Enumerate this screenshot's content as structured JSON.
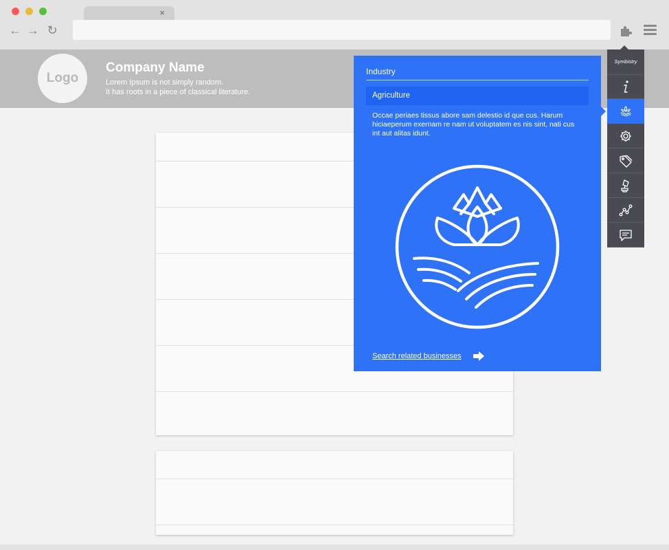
{
  "browser": {
    "colors": {
      "close": "#fc5b57",
      "minimize": "#e5bf3c",
      "maximize": "#57c038"
    },
    "tab_close_label": "×",
    "nav": {
      "back_icon": "←",
      "forward_icon": "→",
      "reload_icon": "↻"
    }
  },
  "site": {
    "logo_text": "Logo",
    "company_name": "Company Name",
    "tagline_line1": "Lorem Ipsum is not simply random.",
    "tagline_line2": "It has roots in a piece of classical literature."
  },
  "popup": {
    "title": "Industry",
    "selected": "Agriculture",
    "description": "Occae periaes tissus abore sam delestio id que cus. Harum hiciaeperum exernam re nam ut voluptatem es nis sint, nati cus int aut alitas idunt.",
    "link_text": "Search related businesses",
    "color": "#2e73f7"
  },
  "sidebar": {
    "title": "Symbistry",
    "active_index": 1,
    "items": [
      {
        "icon": "info-icon"
      },
      {
        "icon": "agriculture-icon"
      },
      {
        "icon": "gear-icon"
      },
      {
        "icon": "tag-icon"
      },
      {
        "icon": "award-icon"
      },
      {
        "icon": "network-icon"
      },
      {
        "icon": "comment-icon"
      }
    ]
  }
}
